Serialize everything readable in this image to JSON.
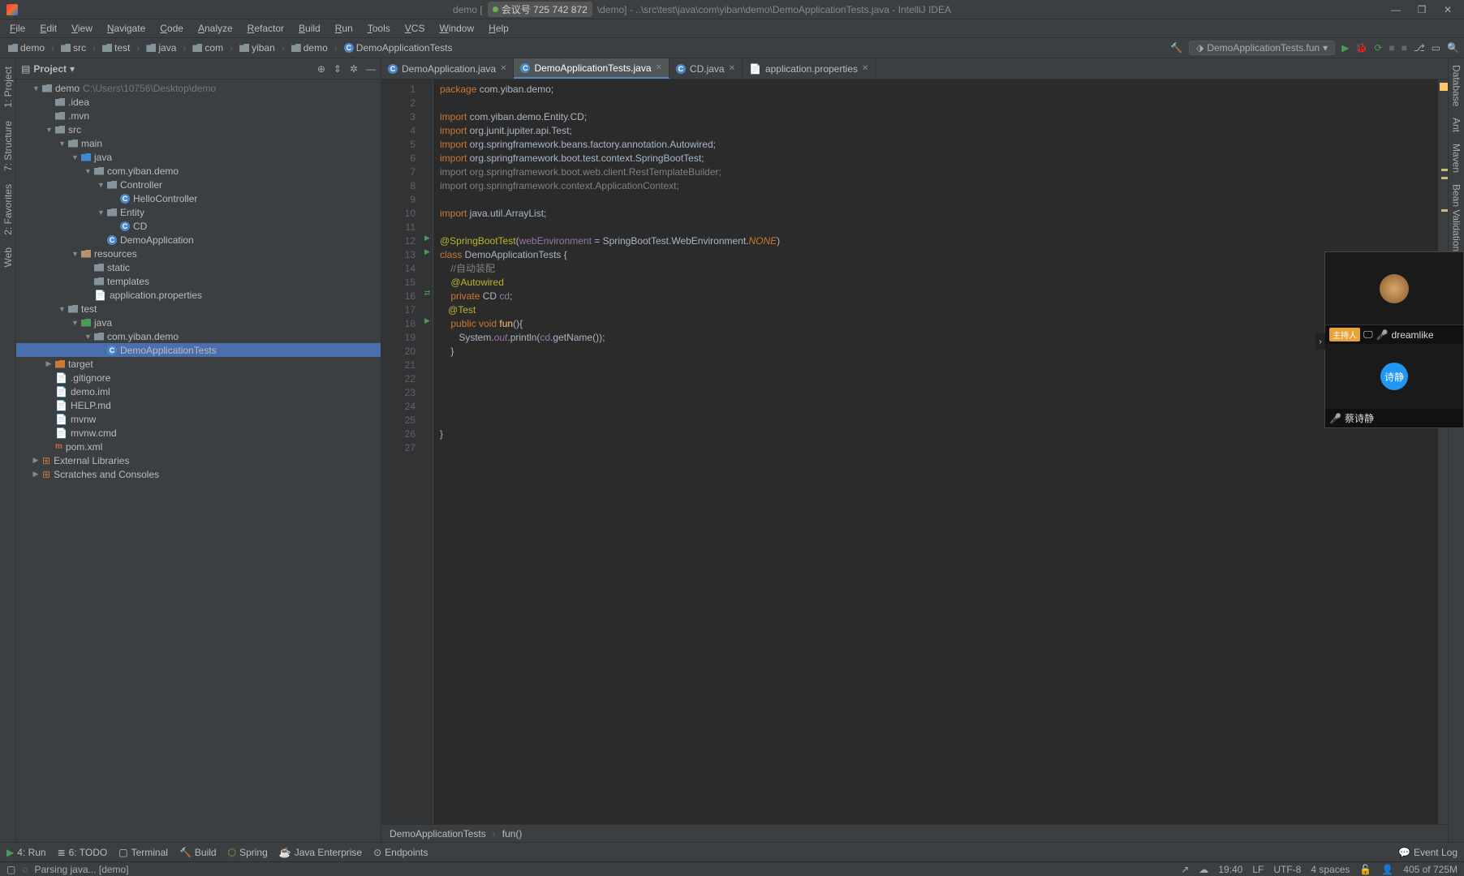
{
  "title": {
    "meeting_label": "会议号 725 742 872",
    "path_partial": "\\demo] - ..\\src\\test\\java\\com\\yiban\\demo\\DemoApplicationTests.java - IntelliJ IDEA",
    "prefix": "demo ["
  },
  "menu": [
    "File",
    "Edit",
    "View",
    "Navigate",
    "Code",
    "Analyze",
    "Refactor",
    "Build",
    "Run",
    "Tools",
    "VCS",
    "Window",
    "Help"
  ],
  "breadcrumbs": [
    {
      "label": "demo",
      "icon": "dir"
    },
    {
      "label": "src",
      "icon": "dir"
    },
    {
      "label": "test",
      "icon": "dir"
    },
    {
      "label": "java",
      "icon": "dir"
    },
    {
      "label": "com",
      "icon": "dir"
    },
    {
      "label": "yiban",
      "icon": "dir"
    },
    {
      "label": "demo",
      "icon": "dir"
    },
    {
      "label": "DemoApplicationTests",
      "icon": "cls"
    }
  ],
  "run_config": "DemoApplicationTests.fun",
  "project": {
    "title": "Project",
    "root": {
      "label": "demo",
      "path": "C:\\Users\\10756\\Desktop\\demo"
    }
  },
  "tree": [
    {
      "d": 0,
      "a": "▼",
      "i": "dir",
      "t": "demo",
      "extra": "C:\\Users\\10756\\Desktop\\demo"
    },
    {
      "d": 1,
      "a": "",
      "i": "dir",
      "t": ".idea"
    },
    {
      "d": 1,
      "a": "",
      "i": "dir",
      "t": ".mvn"
    },
    {
      "d": 1,
      "a": "▼",
      "i": "dir",
      "t": "src"
    },
    {
      "d": 2,
      "a": "▼",
      "i": "dir",
      "t": "main"
    },
    {
      "d": 3,
      "a": "▼",
      "i": "sf",
      "t": "java"
    },
    {
      "d": 4,
      "a": "▼",
      "i": "dir",
      "t": "com.yiban.demo"
    },
    {
      "d": 5,
      "a": "▼",
      "i": "dir",
      "t": "Controller"
    },
    {
      "d": 6,
      "a": "",
      "i": "cls",
      "t": "HelloController"
    },
    {
      "d": 5,
      "a": "▼",
      "i": "dir",
      "t": "Entity"
    },
    {
      "d": 6,
      "a": "",
      "i": "cls",
      "t": "CD"
    },
    {
      "d": 5,
      "a": "",
      "i": "cls",
      "t": "DemoApplication"
    },
    {
      "d": 3,
      "a": "▼",
      "i": "rf",
      "t": "resources"
    },
    {
      "d": 4,
      "a": "",
      "i": "dir",
      "t": "static"
    },
    {
      "d": 4,
      "a": "",
      "i": "dir",
      "t": "templates"
    },
    {
      "d": 4,
      "a": "",
      "i": "file",
      "t": "application.properties"
    },
    {
      "d": 2,
      "a": "▼",
      "i": "dir",
      "t": "test"
    },
    {
      "d": 3,
      "a": "▼",
      "i": "tf",
      "t": "java"
    },
    {
      "d": 4,
      "a": "▼",
      "i": "dir",
      "t": "com.yiban.demo"
    },
    {
      "d": 5,
      "a": "",
      "i": "cls",
      "t": "DemoApplicationTests",
      "sel": true
    },
    {
      "d": 1,
      "a": "▶",
      "i": "tgt",
      "t": "target"
    },
    {
      "d": 1,
      "a": "",
      "i": "file",
      "t": ".gitignore"
    },
    {
      "d": 1,
      "a": "",
      "i": "file",
      "t": "demo.iml"
    },
    {
      "d": 1,
      "a": "",
      "i": "file",
      "t": "HELP.md"
    },
    {
      "d": 1,
      "a": "",
      "i": "file",
      "t": "mvnw"
    },
    {
      "d": 1,
      "a": "",
      "i": "file",
      "t": "mvnw.cmd"
    },
    {
      "d": 1,
      "a": "",
      "i": "pom",
      "t": "pom.xml"
    },
    {
      "d": 0,
      "a": "▶",
      "i": "lib",
      "t": "External Libraries"
    },
    {
      "d": 0,
      "a": "▶",
      "i": "scr",
      "t": "Scratches and Consoles"
    }
  ],
  "tabs": [
    {
      "label": "DemoApplication.java",
      "icon": "cls"
    },
    {
      "label": "DemoApplicationTests.java",
      "icon": "cls",
      "active": true
    },
    {
      "label": "CD.java",
      "icon": "cls"
    },
    {
      "label": "application.properties",
      "icon": "file"
    }
  ],
  "code_lines": [
    {
      "n": 1,
      "h": "<span class='kw'>package</span> com.yiban.demo;"
    },
    {
      "n": 2,
      "h": ""
    },
    {
      "n": 3,
      "h": "<span class='kw'>import</span> com.yiban.demo.Entity.CD;"
    },
    {
      "n": 4,
      "h": "<span class='kw'>import</span> org.junit.jupiter.api.Test;"
    },
    {
      "n": 5,
      "h": "<span class='kw'>import</span> org.springframework.beans.factory.annotation.<span class='typ'>Autowired</span>;"
    },
    {
      "n": 6,
      "h": "<span class='kw'>import</span> org.springframework.boot.test.context.<span class='typ'>SpringBootTest</span>;"
    },
    {
      "n": 7,
      "h": "<span class='cmt'>import org.springframework.boot.web.client.RestTemplateBuilder;</span>"
    },
    {
      "n": 8,
      "h": "<span class='cmt'>import org.springframework.context.ApplicationContext;</span>"
    },
    {
      "n": 9,
      "h": ""
    },
    {
      "n": 10,
      "h": "<span class='kw'>import</span> java.util.ArrayList;"
    },
    {
      "n": 11,
      "h": ""
    },
    {
      "n": 12,
      "h": "<span class='ann'>@SpringBootTest</span>(<span class='fld'>webEnvironment</span> = SpringBootTest.WebEnvironment.<span class='lit'>NONE</span>)",
      "mk": "▶"
    },
    {
      "n": 13,
      "h": "<span class='kw'>class</span> DemoApplicationTests {",
      "mk": "▶"
    },
    {
      "n": 14,
      "h": "    <span class='cmt'>//自动装配</span>"
    },
    {
      "n": 15,
      "h": "    <span class='ann'>@Autowired</span>"
    },
    {
      "n": 16,
      "h": "    <span class='kw'>private</span> CD <span class='fld'>cd</span>;",
      "mk": "⇄"
    },
    {
      "n": 17,
      "h": "   <span class='ann'>@Test</span>"
    },
    {
      "n": 18,
      "h": "    <span class='kw'>public void</span> <span class='mth'>fun</span>(){",
      "mk": "▶"
    },
    {
      "n": 19,
      "h": "       System.<span class='st'>out</span>.println(<span class='fld'>cd</span>.getName());"
    },
    {
      "n": 20,
      "h": "    }"
    },
    {
      "n": 21,
      "h": ""
    },
    {
      "n": 22,
      "h": ""
    },
    {
      "n": 23,
      "h": ""
    },
    {
      "n": 24,
      "h": ""
    },
    {
      "n": 25,
      "h": ""
    },
    {
      "n": 26,
      "h": "}"
    },
    {
      "n": 27,
      "h": ""
    }
  ],
  "editor_crumb": {
    "class": "DemoApplicationTests",
    "method": "fun()"
  },
  "bottom": {
    "run": "4: Run",
    "todo": "6: TODO",
    "terminal": "Terminal",
    "build": "Build",
    "spring": "Spring",
    "javaee": "Java Enterprise",
    "endpoints": "Endpoints",
    "eventlog": "Event Log"
  },
  "status": {
    "task": "Parsing java... [demo]",
    "pos": "19:40",
    "le": "LF",
    "enc": "UTF-8",
    "indent": "4 spaces",
    "mem": "405 of 725M"
  },
  "overlay": {
    "host_badge": "主持人",
    "user1": "dreamlike",
    "avatar2": "诗静",
    "user2": "蔡诗静"
  },
  "rails": {
    "left": [
      "1: Project",
      "7: Structure",
      "2: Favorites",
      "Web"
    ],
    "right": [
      "Database",
      "Ant",
      "Maven",
      "Bean Validation"
    ]
  }
}
